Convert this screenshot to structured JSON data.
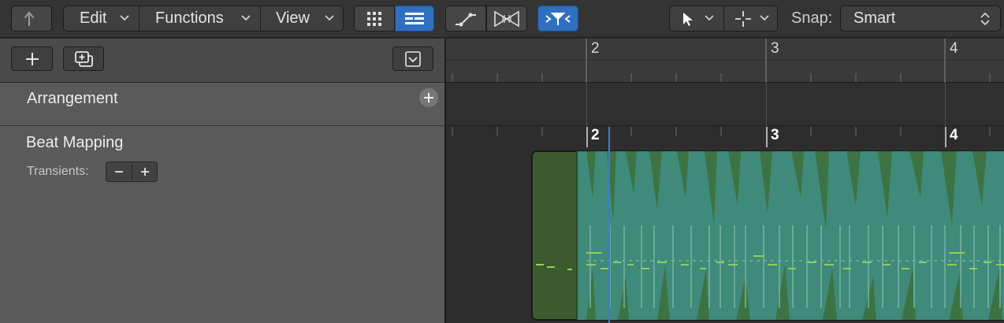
{
  "toolbar": {
    "back_icon": "back-arrow-icon",
    "menus": [
      {
        "label": "Edit"
      },
      {
        "label": "Functions"
      },
      {
        "label": "View"
      }
    ],
    "chevron_icon": "chevron-down-icon",
    "view_buttons": [
      {
        "icon": "grid-view-icon",
        "active": false
      },
      {
        "icon": "list-view-icon",
        "active": true
      }
    ],
    "tool_buttons": [
      {
        "icon": "automation-curve-icon"
      },
      {
        "icon": "flex-time-icon"
      },
      {
        "icon": "catch-playhead-icon",
        "active": true
      }
    ],
    "pointer_tool_icon": "pointer-tool-icon",
    "crosshair_tool_icon": "crosshair-tool-icon",
    "snap_label": "Snap:",
    "snap_value": "Smart",
    "accent_color": "#2f6fc0"
  },
  "inspector": {
    "add_button_icon": "plus-icon",
    "duplicate_button_icon": "duplicate-track-icon",
    "collapse_button_icon": "collapse-down-icon",
    "arrangement": {
      "title": "Arrangement",
      "add_icon": "plus-icon"
    },
    "beat_mapping": {
      "title": "Beat Mapping",
      "transients_label": "Transients:",
      "minus_icon": "minus-icon",
      "plus_icon": "plus-icon"
    }
  },
  "timeline": {
    "bars": [
      "2",
      "3",
      "4"
    ],
    "region_color": "#3f8a7a",
    "region_dark_color": "#3b5a2d",
    "playhead_color": "#3a7bd5"
  }
}
